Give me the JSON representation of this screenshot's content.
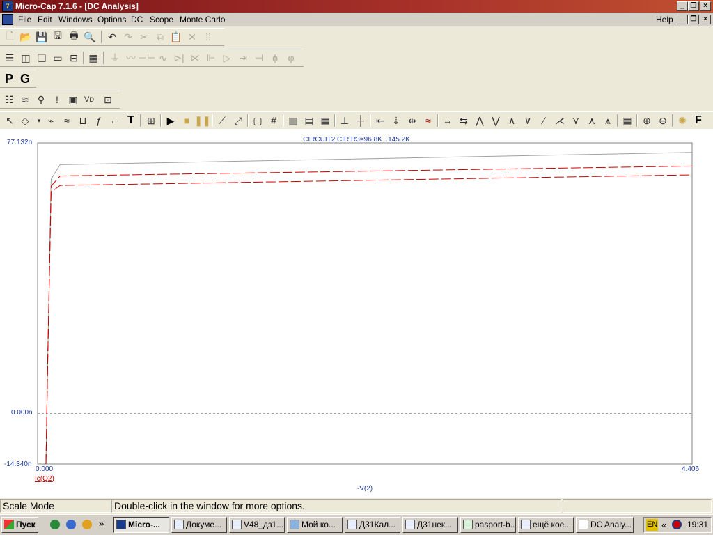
{
  "window": {
    "title": "Micro-Cap 7.1.6 - [DC Analysis]",
    "app_icon_text": "7"
  },
  "menu": {
    "items": [
      "File",
      "Edit",
      "Windows",
      "Options",
      "DC",
      "Scope",
      "Monte Carlo"
    ],
    "help": "Help"
  },
  "toolbar_row3": {
    "p_label": "P",
    "g_label": "G"
  },
  "toolbar_row5": {
    "text_tool": "T",
    "font_tool": "F"
  },
  "plot": {
    "title": "CIRCUIT2.CIR R3=96.8K...145.2K",
    "y_max_label": "77.132n",
    "y_zero_label": "0.000n",
    "y_min_label": "-14.340n",
    "x_min_label": "0.000",
    "x_max_label": "4.406",
    "x_axis_label": "-V(2)",
    "y_axis_label": "Ic(Q2)"
  },
  "chart_data": {
    "type": "line",
    "title": "CIRCUIT2.CIR R3=96.8K...145.2K",
    "xlabel": "-V(2)",
    "ylabel": "Ic(Q2)",
    "xlim": [
      0,
      4.406
    ],
    "ylim": [
      -14.34,
      77.132
    ],
    "y_unit": "n",
    "grid": false,
    "series": [
      {
        "color": "#a0a0a0",
        "x": [
          0.0,
          0.013,
          0.035,
          0.097,
          4.406
        ],
        "y": [
          -14.34,
          17.0,
          66.8,
          70.9,
          74.4
        ]
      },
      {
        "color": "#cc0000",
        "x": [
          0.0,
          0.013,
          0.035,
          0.097,
          4.406
        ],
        "y": [
          -14.34,
          17.0,
          64.8,
          67.7,
          70.5
        ]
      },
      {
        "color": "#cc0000",
        "x": [
          0.0,
          0.013,
          0.035,
          0.097,
          4.406
        ],
        "y": [
          -14.34,
          17.0,
          63.1,
          65.0,
          68.0
        ]
      }
    ]
  },
  "status": {
    "mode": "Scale Mode",
    "hint": "Double-click in the window for more options."
  },
  "taskbar": {
    "start": "Пуск",
    "chevron": "»",
    "tasks": [
      "Micro-...",
      "Докуме...",
      "V48_дз1...",
      "Мой ко...",
      "Д31Кал...",
      "Д31нек...",
      "pasport-b...",
      "ещё кое...",
      "DC Analy..."
    ],
    "lang": "EN",
    "tray_chevron": "«",
    "clock": "19:31"
  }
}
